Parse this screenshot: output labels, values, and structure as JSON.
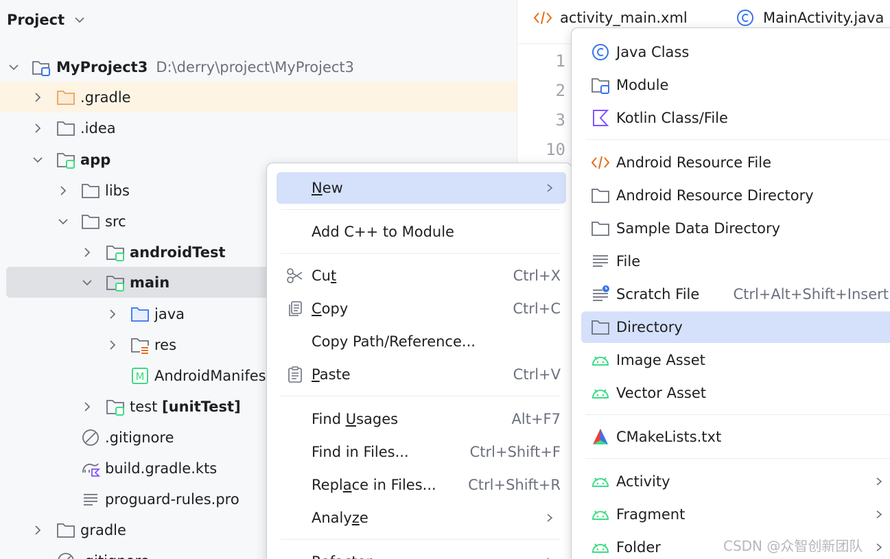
{
  "project_panel": {
    "title": "Project",
    "tree": [
      {
        "label": "MyProject3",
        "path": "D:\\derry\\project\\MyProject3"
      },
      {
        "label": ".gradle"
      },
      {
        "label": ".idea"
      },
      {
        "label": "app"
      },
      {
        "label": "libs"
      },
      {
        "label": "src"
      },
      {
        "label": "androidTest"
      },
      {
        "label": "main"
      },
      {
        "label": "java"
      },
      {
        "label": "res"
      },
      {
        "label": "AndroidManifes"
      },
      {
        "label": "test",
        "suffix": "[unitTest]"
      },
      {
        "label": ".gitignore"
      },
      {
        "label": "build.gradle.kts"
      },
      {
        "label": "proguard-rules.pro"
      },
      {
        "label": "gradle"
      },
      {
        "label": ".gitignore"
      }
    ]
  },
  "editor": {
    "tabs": [
      {
        "label": "activity_main.xml",
        "icon": "xml-icon"
      },
      {
        "label": "MainActivity.java",
        "icon": "java-class-icon"
      }
    ],
    "line_numbers": [
      "1",
      "2",
      "3",
      "10"
    ]
  },
  "context_menu": {
    "items": [
      {
        "label": "New",
        "mnemonic": "N",
        "rest": "ew",
        "has_submenu": true
      },
      {
        "label": "Add C++ to Module"
      },
      {
        "label_pre": "Cu",
        "mnemonic": "t",
        "label_post": "",
        "shortcut": "Ctrl+X",
        "icon": "scissors-icon"
      },
      {
        "label_pre": "",
        "mnemonic": "C",
        "label_post": "opy",
        "shortcut": "Ctrl+C",
        "icon": "copy-icon"
      },
      {
        "label": "Copy Path/Reference..."
      },
      {
        "label_pre": "",
        "mnemonic": "P",
        "label_post": "aste",
        "shortcut": "Ctrl+V",
        "icon": "paste-icon"
      },
      {
        "label_pre": "Find ",
        "mnemonic": "U",
        "label_post": "sages",
        "shortcut": "Alt+F7"
      },
      {
        "label": "Find in Files...",
        "shortcut": "Ctrl+Shift+F"
      },
      {
        "label_pre": "Repl",
        "mnemonic": "a",
        "label_post": "ce in Files...",
        "shortcut": "Ctrl+Shift+R"
      },
      {
        "label_pre": "Analy",
        "mnemonic": "z",
        "label_post": "e",
        "has_submenu": true
      },
      {
        "label": "Refactor",
        "has_submenu": true
      }
    ]
  },
  "submenu": {
    "items": [
      {
        "label": "Java Class",
        "icon": "java-class-icon"
      },
      {
        "label": "Module",
        "icon": "module-icon"
      },
      {
        "label": "Kotlin Class/File",
        "icon": "kotlin-icon"
      },
      {
        "label": "Android Resource File",
        "icon": "xml-icon"
      },
      {
        "label": "Android Resource Directory",
        "icon": "folder-icon"
      },
      {
        "label": "Sample Data Directory",
        "icon": "folder-icon"
      },
      {
        "label": "File",
        "icon": "file-icon"
      },
      {
        "label": "Scratch File",
        "shortcut": "Ctrl+Alt+Shift+Insert",
        "icon": "scratch-file-icon"
      },
      {
        "label": "Directory",
        "icon": "folder-icon"
      },
      {
        "label": "Image Asset",
        "icon": "android-icon"
      },
      {
        "label": "Vector Asset",
        "icon": "android-icon"
      },
      {
        "label": "CMakeLists.txt",
        "icon": "cmake-icon"
      },
      {
        "label": "Activity",
        "icon": "android-icon",
        "has_submenu": true
      },
      {
        "label": "Fragment",
        "icon": "android-icon",
        "has_submenu": true
      },
      {
        "label": "Folder",
        "icon": "android-icon",
        "has_submenu": true
      }
    ]
  },
  "watermark": "CSDN @众智创新团队",
  "colors": {
    "accent_selection": "#d5e1fb",
    "tree_selection": "#dfe1e5",
    "gradle_highlight": "#fdf4e3",
    "android_green": "#3ddc84",
    "folder_orange": "#e8a35b",
    "java_blue": "#3574f0"
  }
}
